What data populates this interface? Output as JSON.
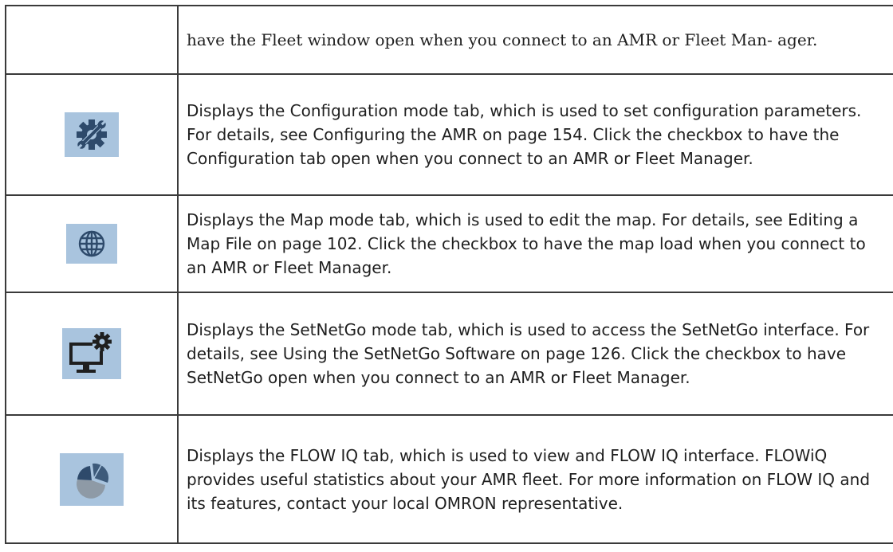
{
  "rows": [
    {
      "icon": "",
      "text": "have the Fleet window open when you connect to an AMR or Fleet Man- ager."
    },
    {
      "icon": "configuration-icon",
      "text": "Displays the Configuration mode tab, which is used to set configuration parameters. For details, see Configuring the AMR on page 154. Click the checkbox to have the Configuration tab open when you connect to an AMR or Fleet Manager."
    },
    {
      "icon": "globe-icon",
      "text": "Displays the Map mode tab, which is used to edit the map. For details, see Editing a Map File on page 102. Click the checkbox to have the map load when you connect to an AMR or Fleet Manager."
    },
    {
      "icon": "monitor-gear-icon",
      "text": "Displays the SetNetGo mode tab, which is used to access the SetNetGo interface. For details, see Using the SetNetGo Software on page 126. Click the checkbox to have SetNetGo open when you connect to an AMR or Fleet Manager."
    },
    {
      "icon": "pie-chart-icon",
      "text": "Displays the FLOW IQ tab, which is used to view and FLOW IQ interface. FLOWiQ provides useful statistics about your AMR fleet. For more information on FLOW IQ and its features, contact your local OMRON representative."
    }
  ],
  "colors": {
    "icon_background": "#a9c4de",
    "icon_dark": "#2e4a6b",
    "border": "#3a3a3a"
  }
}
